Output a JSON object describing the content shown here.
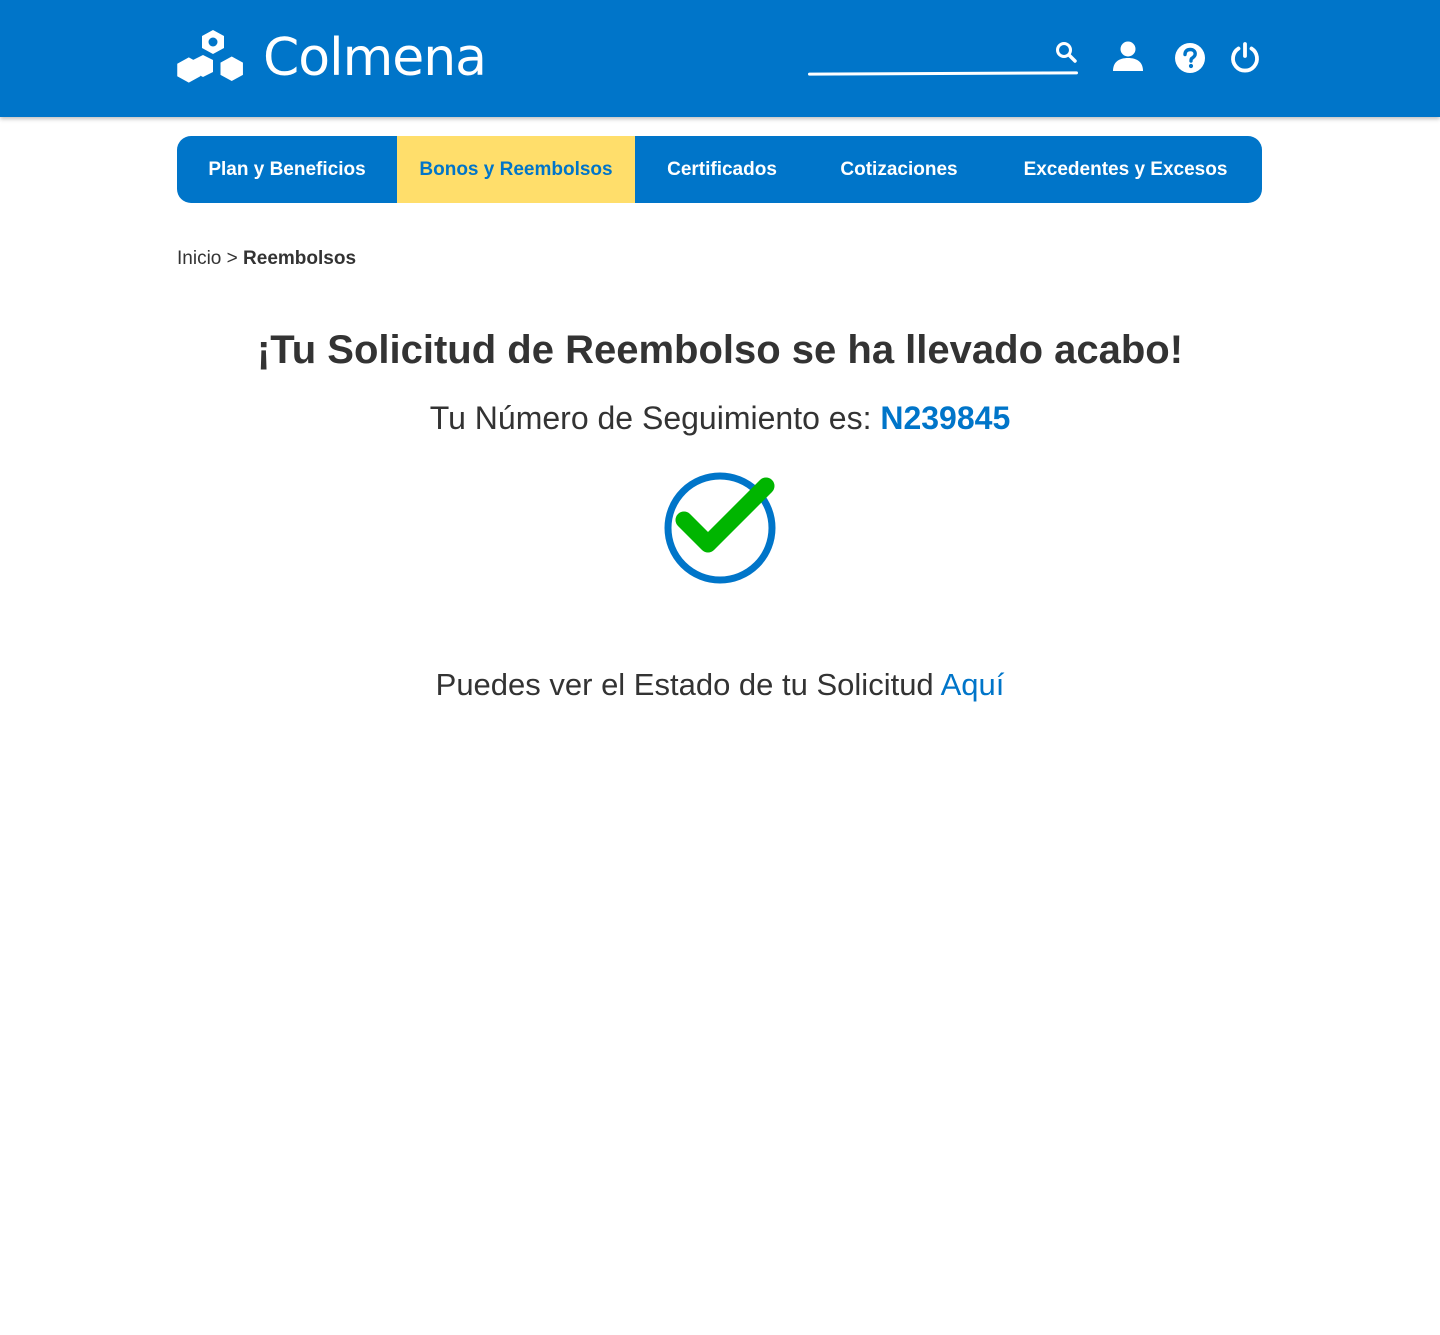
{
  "header": {
    "brand": "Colmena",
    "search": {
      "placeholder": "",
      "value": ""
    },
    "icons": [
      "search-icon",
      "user-icon",
      "help-icon",
      "power-icon"
    ]
  },
  "nav": {
    "items": [
      {
        "label": "Plan y Beneficios",
        "active": false
      },
      {
        "label": "Bonos y Reembolsos",
        "active": true
      },
      {
        "label": "Certificados",
        "active": false
      },
      {
        "label": "Cotizaciones",
        "active": false
      },
      {
        "label": "Excedentes y Excesos",
        "active": false
      }
    ]
  },
  "breadcrumb": {
    "home": "Inicio",
    "separator": ">",
    "current": "Reembolsos"
  },
  "main": {
    "title": "¡Tu Solicitud de Reembolso se ha llevado acabo!",
    "tracking_label": "Tu Número de Seguimiento es:",
    "tracking_number": "N239845",
    "status_text": "Puedes ver el Estado de tu Solicitud",
    "status_link": "Aquí"
  },
  "colors": {
    "primary": "#0075C9",
    "accent": "#FFDE6B",
    "success": "#00B500",
    "text": "#333333",
    "background": "#FFFFFF"
  }
}
